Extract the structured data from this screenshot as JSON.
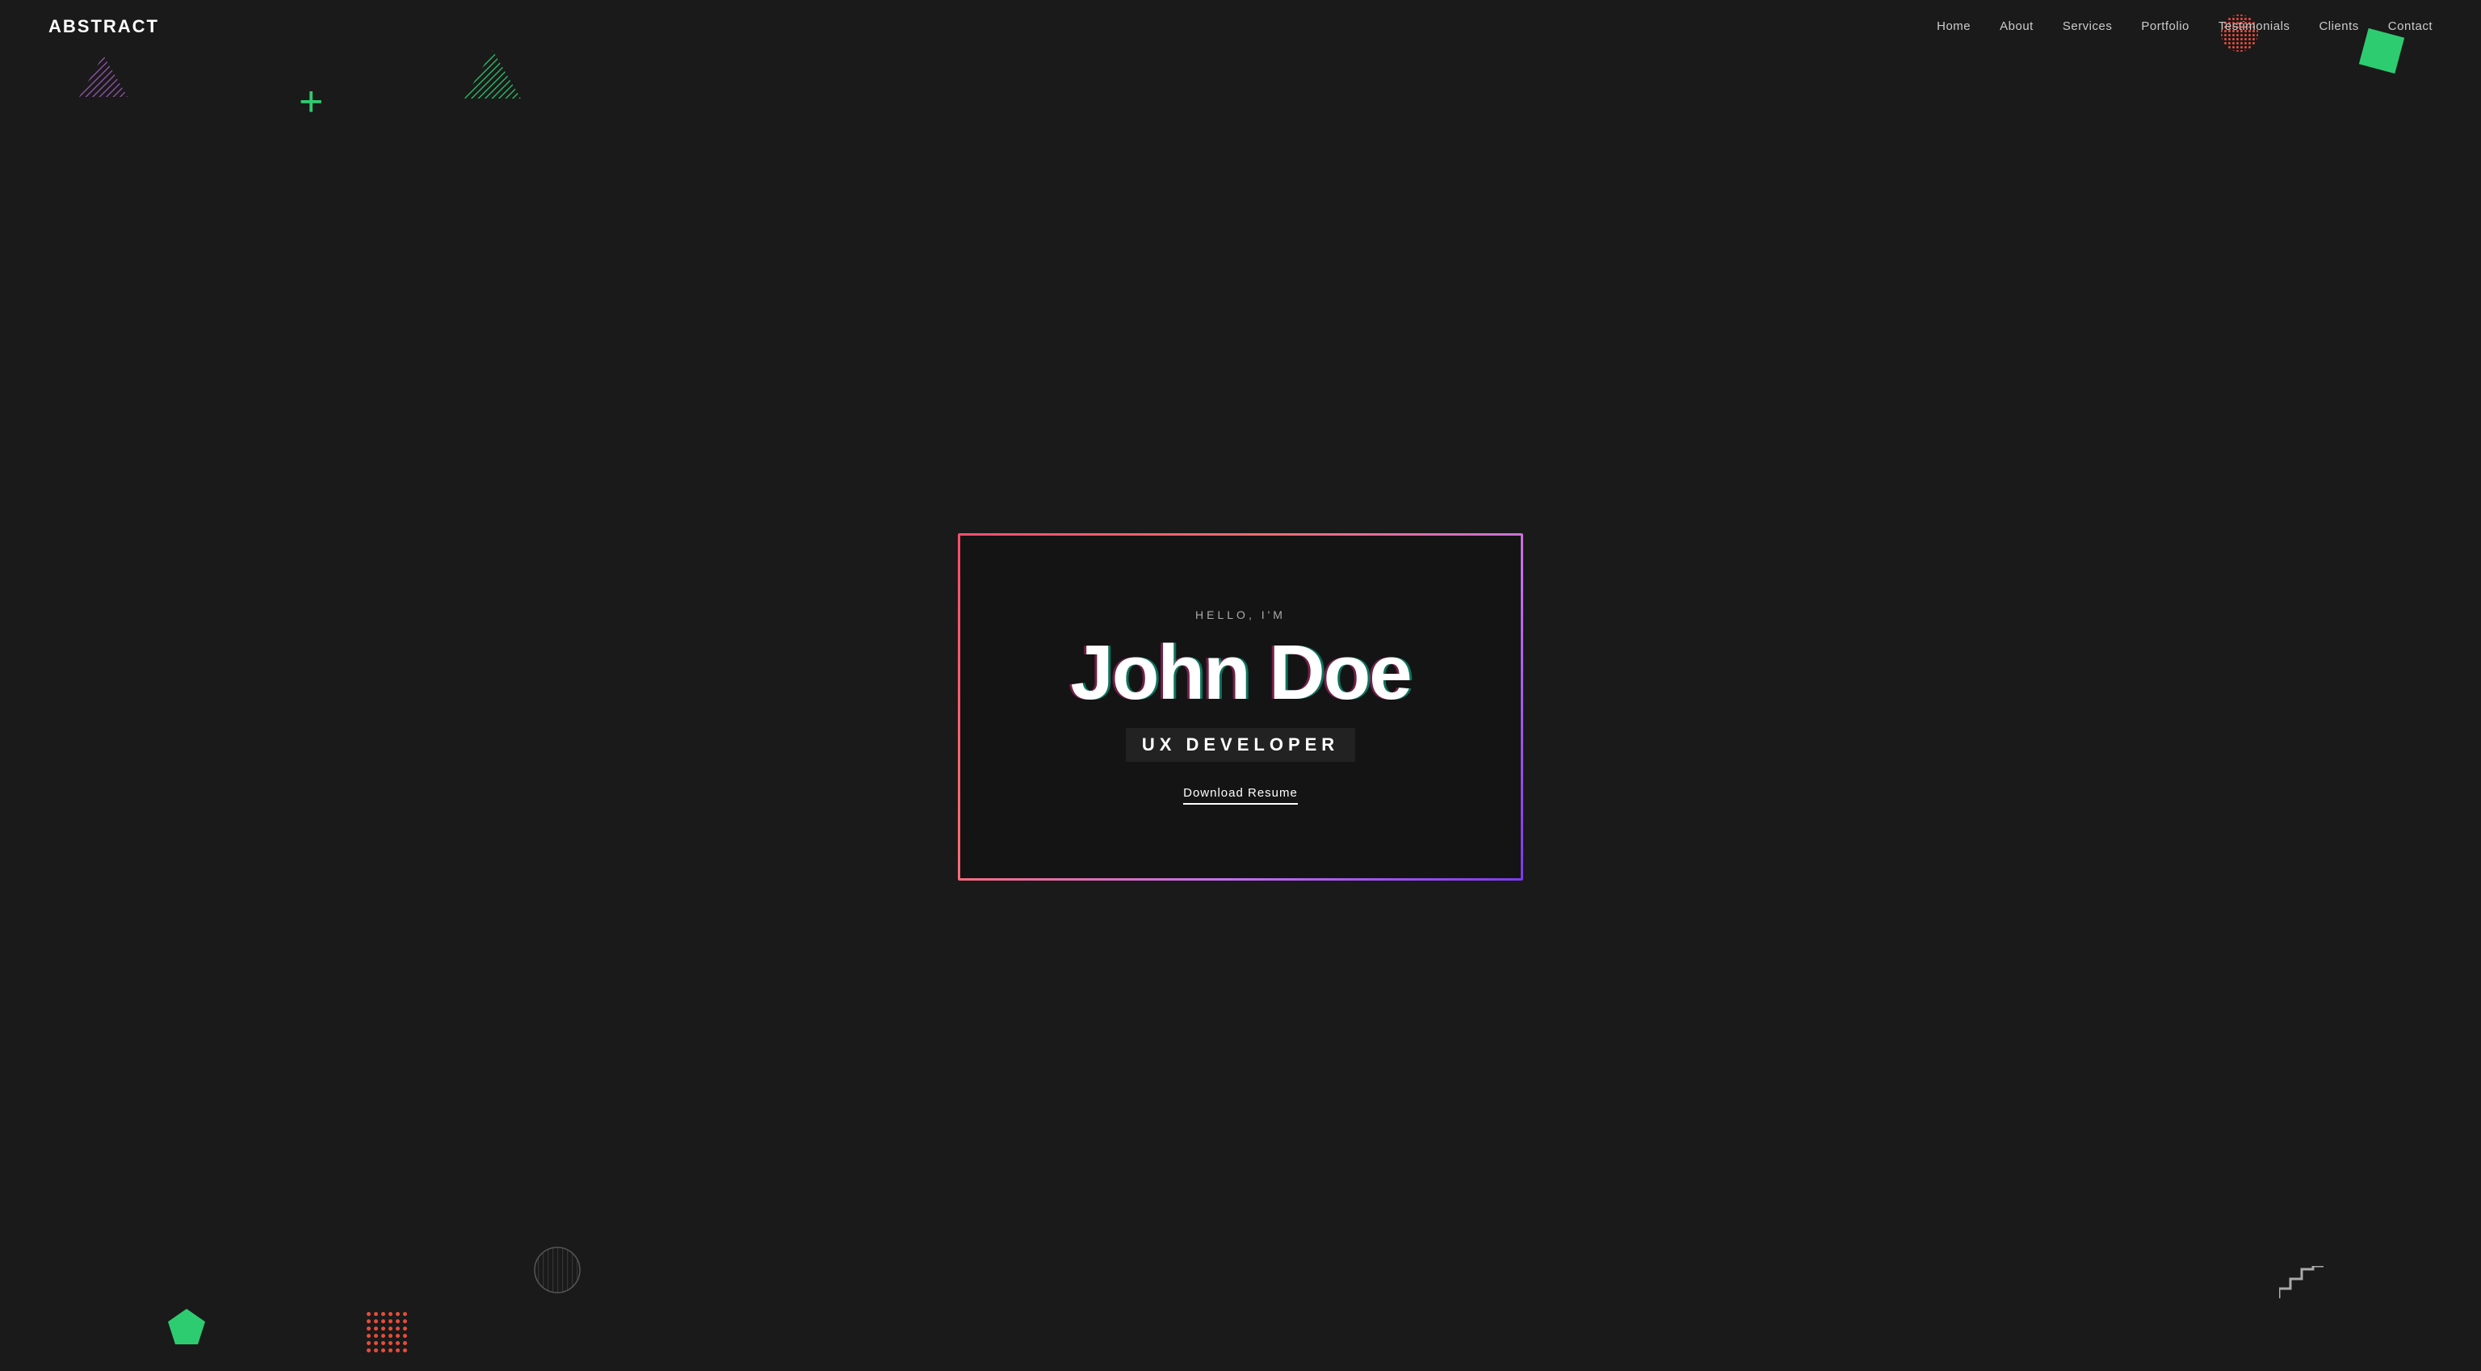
{
  "logo": "ABSTRACT",
  "nav": {
    "links": [
      {
        "label": "Home",
        "href": "#"
      },
      {
        "label": "About",
        "href": "#"
      },
      {
        "label": "Services",
        "href": "#"
      },
      {
        "label": "Portfolio",
        "href": "#"
      },
      {
        "label": "Testimonials",
        "href": "#"
      },
      {
        "label": "Clients",
        "href": "#"
      },
      {
        "label": "Contact",
        "href": "#"
      }
    ]
  },
  "hero": {
    "greeting": "HELLO, I'M",
    "name": "John Doe",
    "title": "UX DEVELOPER",
    "cta": "Download Resume"
  },
  "shapes": {
    "plus": "+",
    "accent_color": "#2ecc71"
  }
}
